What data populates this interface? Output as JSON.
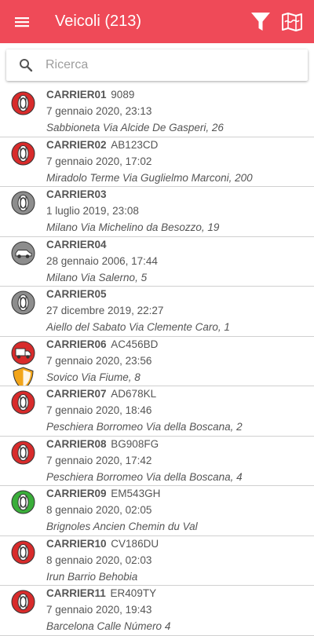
{
  "appbar": {
    "title": "Veicoli (213)",
    "color": "#ef4a58",
    "menu_icon": "hamburger-menu-icon",
    "filter_icon": "filter-funnel-icon",
    "map_icon": "folded-map-icon"
  },
  "search": {
    "placeholder": "Ricerca",
    "value": ""
  },
  "status_colors": {
    "red": "#d82b2b",
    "grey": "#8d8d8d",
    "green": "#3aae3a",
    "orange": "#f2a51a"
  },
  "vehicles": [
    {
      "name": "CARRIER01",
      "plate": "9089",
      "datetime": "7 gennaio 2020, 23:13",
      "address": "Sabbioneta Via Alcide De Gasperi, 26",
      "status": "red",
      "icon": "tire-icon"
    },
    {
      "name": "CARRIER02",
      "plate": "AB123CD",
      "datetime": "7 gennaio 2020, 17:02",
      "address": "Miradolo Terme Via Guglielmo Marconi, 200",
      "status": "red",
      "icon": "tire-icon"
    },
    {
      "name": "CARRIER03",
      "plate": "",
      "datetime": "1 luglio 2019, 23:08",
      "address": "Milano Via Michelino da Besozzo, 19",
      "status": "grey",
      "icon": "tire-icon"
    },
    {
      "name": "CARRIER04",
      "plate": "",
      "datetime": "28 gennaio 2006, 17:44",
      "address": "Milano Via Salerno, 5",
      "status": "grey",
      "icon": "car-icon"
    },
    {
      "name": "CARRIER05",
      "plate": "",
      "datetime": "27 dicembre 2019, 22:27",
      "address": "Aiello del Sabato Via Clemente Caro, 1",
      "status": "grey",
      "icon": "tire-icon"
    },
    {
      "name": "CARRIER06",
      "plate": "AC456BD",
      "datetime": "7 gennaio 2020, 23:56",
      "address": "Sovico Via Fiume, 8",
      "status": "red",
      "icon": "truck-icon",
      "secondary_icon": "shield-icon"
    },
    {
      "name": "CARRIER07",
      "plate": "AD678KL",
      "datetime": "7 gennaio 2020, 18:46",
      "address": "Peschiera Borromeo Via della Boscana, 2",
      "status": "red",
      "icon": "tire-icon"
    },
    {
      "name": "CARRIER08",
      "plate": "BG908FG",
      "datetime": "7 gennaio 2020, 17:42",
      "address": "Peschiera Borromeo Via della Boscana, 4",
      "status": "red",
      "icon": "tire-icon"
    },
    {
      "name": "CARRIER09",
      "plate": "EM543GH",
      "datetime": "8 gennaio 2020, 02:05",
      "address": "Brignoles Ancien Chemin du Val",
      "status": "green",
      "icon": "tire-icon"
    },
    {
      "name": "CARRIER10",
      "plate": "CV186DU",
      "datetime": "8 gennaio 2020, 02:03",
      "address": "Irun Barrio Behobia",
      "status": "red",
      "icon": "tire-icon"
    },
    {
      "name": "CARRIER11",
      "plate": "ER409TY",
      "datetime": "7 gennaio 2020, 19:43",
      "address": "Barcelona Calle Número 4",
      "status": "red",
      "icon": "tire-icon"
    }
  ]
}
